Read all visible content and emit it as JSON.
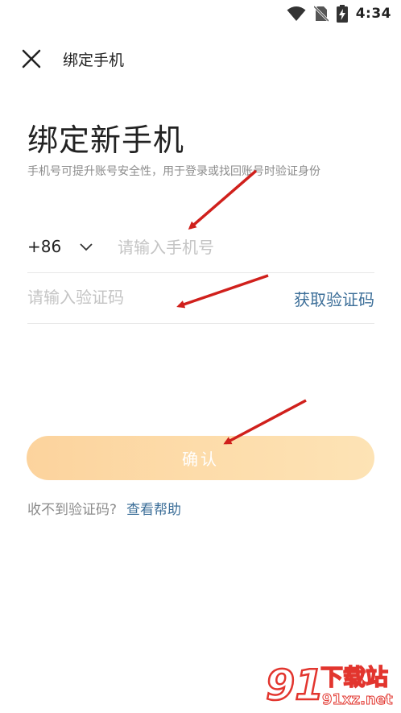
{
  "status_bar": {
    "time": "4:34"
  },
  "toolbar": {
    "title": "绑定手机"
  },
  "main": {
    "title": "绑定新手机",
    "subtitle": "手机号可提升账号安全性，用于登录或找回账号时验证身份"
  },
  "phone": {
    "country_code": "+86",
    "placeholder": "请输入手机号",
    "value": ""
  },
  "code": {
    "placeholder": "请输入验证码",
    "value": "",
    "get_code_label": "获取验证码"
  },
  "confirm": {
    "label": "确认"
  },
  "help": {
    "question": "收不到验证码?",
    "link_label": "查看帮助"
  },
  "watermark": {
    "logo_text": "91",
    "brand_text": "下载站",
    "domain_text": "91xz.net"
  },
  "colors": {
    "accent_link": "#3d6f99",
    "button_gradient_start": "#fcd39d",
    "button_gradient_end": "#fde3b5",
    "annotation_arrow": "#d0201c"
  },
  "icons": [
    "wifi-icon",
    "no-sim-icon",
    "battery-charging-icon",
    "close-icon",
    "chevron-down-icon"
  ]
}
